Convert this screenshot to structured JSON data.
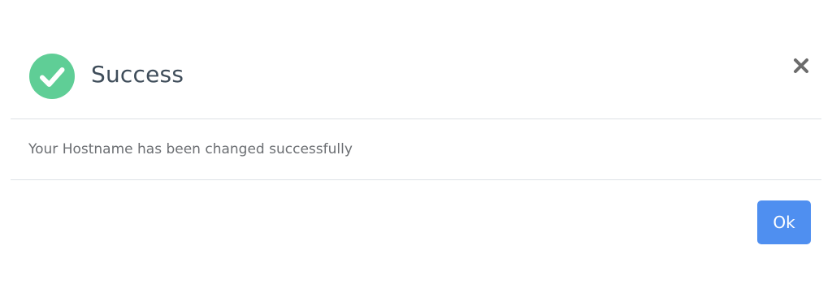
{
  "dialog": {
    "title": "Success",
    "message": "Your Hostname has been changed successfully",
    "ok_label": "Ok",
    "icons": {
      "status": "check-circle-icon",
      "close": "close-icon"
    },
    "colors": {
      "success": "#5fce96",
      "title": "#3f4d5a",
      "message": "#6c6f73",
      "close": "#6b6b6b",
      "button": "#4f8ff0",
      "button_text": "#ffffff",
      "divider": "#dee2e6"
    }
  }
}
